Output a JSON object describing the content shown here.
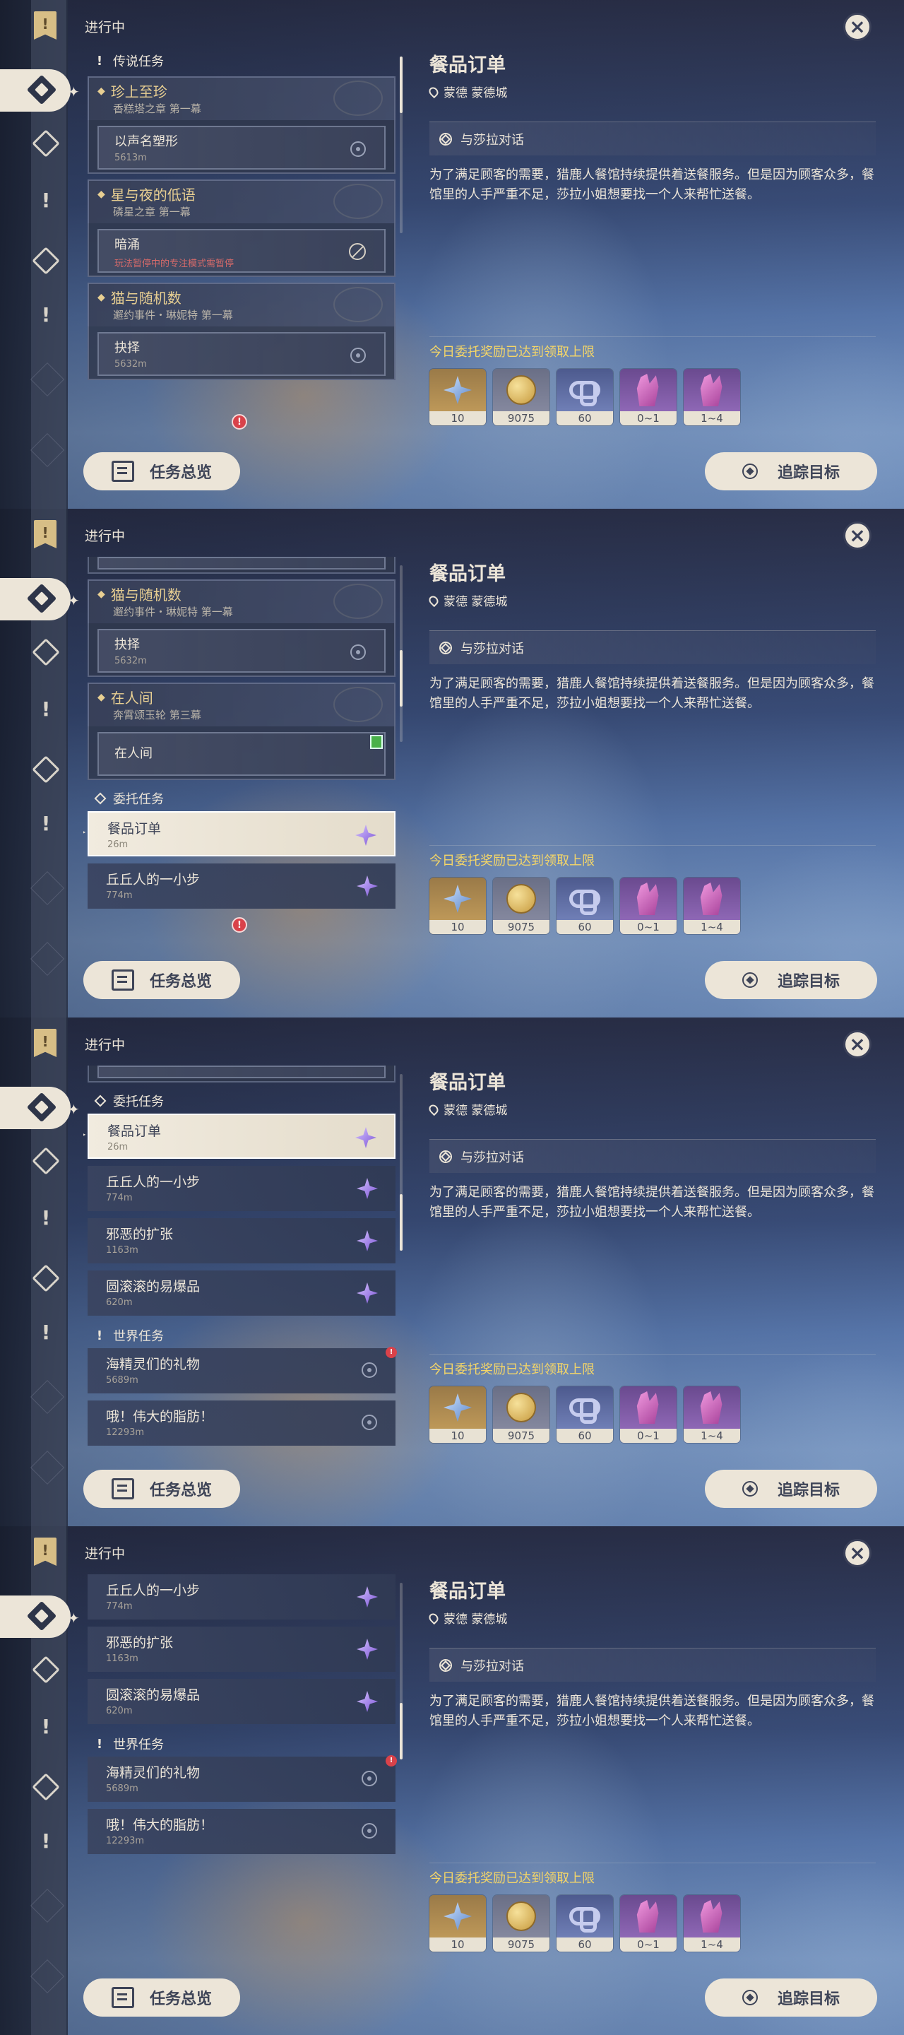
{
  "header": {
    "in_progress": "进行中"
  },
  "groups": {
    "legend": "传说任务",
    "commission": "委托任务",
    "world": "世界任务"
  },
  "quests": {
    "q1": {
      "title": "珍上至珍",
      "sub": "香糕塔之章 第一幕",
      "step": "以声名塑形",
      "dist": "5613m"
    },
    "q2": {
      "title": "星与夜的低语",
      "sub": "磷星之章 第一幕",
      "step": "暗涌",
      "note": "玩法暂停中的专注模式需暂停"
    },
    "q3": {
      "title": "猫与随机数",
      "sub": "邂约事件・琳妮特 第一幕",
      "step": "抉择",
      "dist": "5632m"
    },
    "q4": {
      "title": "在人间",
      "sub": "奔霄颂玉轮 第三幕",
      "step": "在人间"
    },
    "c1": {
      "name": "餐品订单",
      "dist": "26m"
    },
    "c2": {
      "name": "丘丘人的一小步",
      "dist": "774m"
    },
    "c3": {
      "name": "邪恶的扩张",
      "dist": "1163m"
    },
    "c4": {
      "name": "圆滚滚的易爆品",
      "dist": "620m"
    },
    "w1": {
      "name": "海精灵们的礼物",
      "dist": "5689m"
    },
    "w2": {
      "name": "哦！伟大的脂肪！",
      "dist": "12293m"
    }
  },
  "detail": {
    "title": "餐品订单",
    "location": "蒙德 蒙德城",
    "objective": "与莎拉对话",
    "description": "为了满足顾客的需要，猎鹿人餐馆持续提供着送餐服务。但是因为顾客众多，餐馆里的人手严重不足，莎拉小姐想要找一个人来帮忙送餐。",
    "reward_note": "今日委托奖励已达到领取上限",
    "rewards": [
      {
        "name": "exp-icon",
        "qty": "10"
      },
      {
        "name": "mora-icon",
        "qty": "9075"
      },
      {
        "name": "friendship-icon",
        "qty": "60"
      },
      {
        "name": "crystal-icon",
        "qty": "0~1"
      },
      {
        "name": "crystal-icon",
        "qty": "1~4"
      }
    ]
  },
  "buttons": {
    "overview": "任务总览",
    "track": "追踪目标"
  },
  "glyph": {
    "close": "×",
    "alert": "!",
    "excl": "!",
    "star": "✦",
    "quest": "◆"
  }
}
